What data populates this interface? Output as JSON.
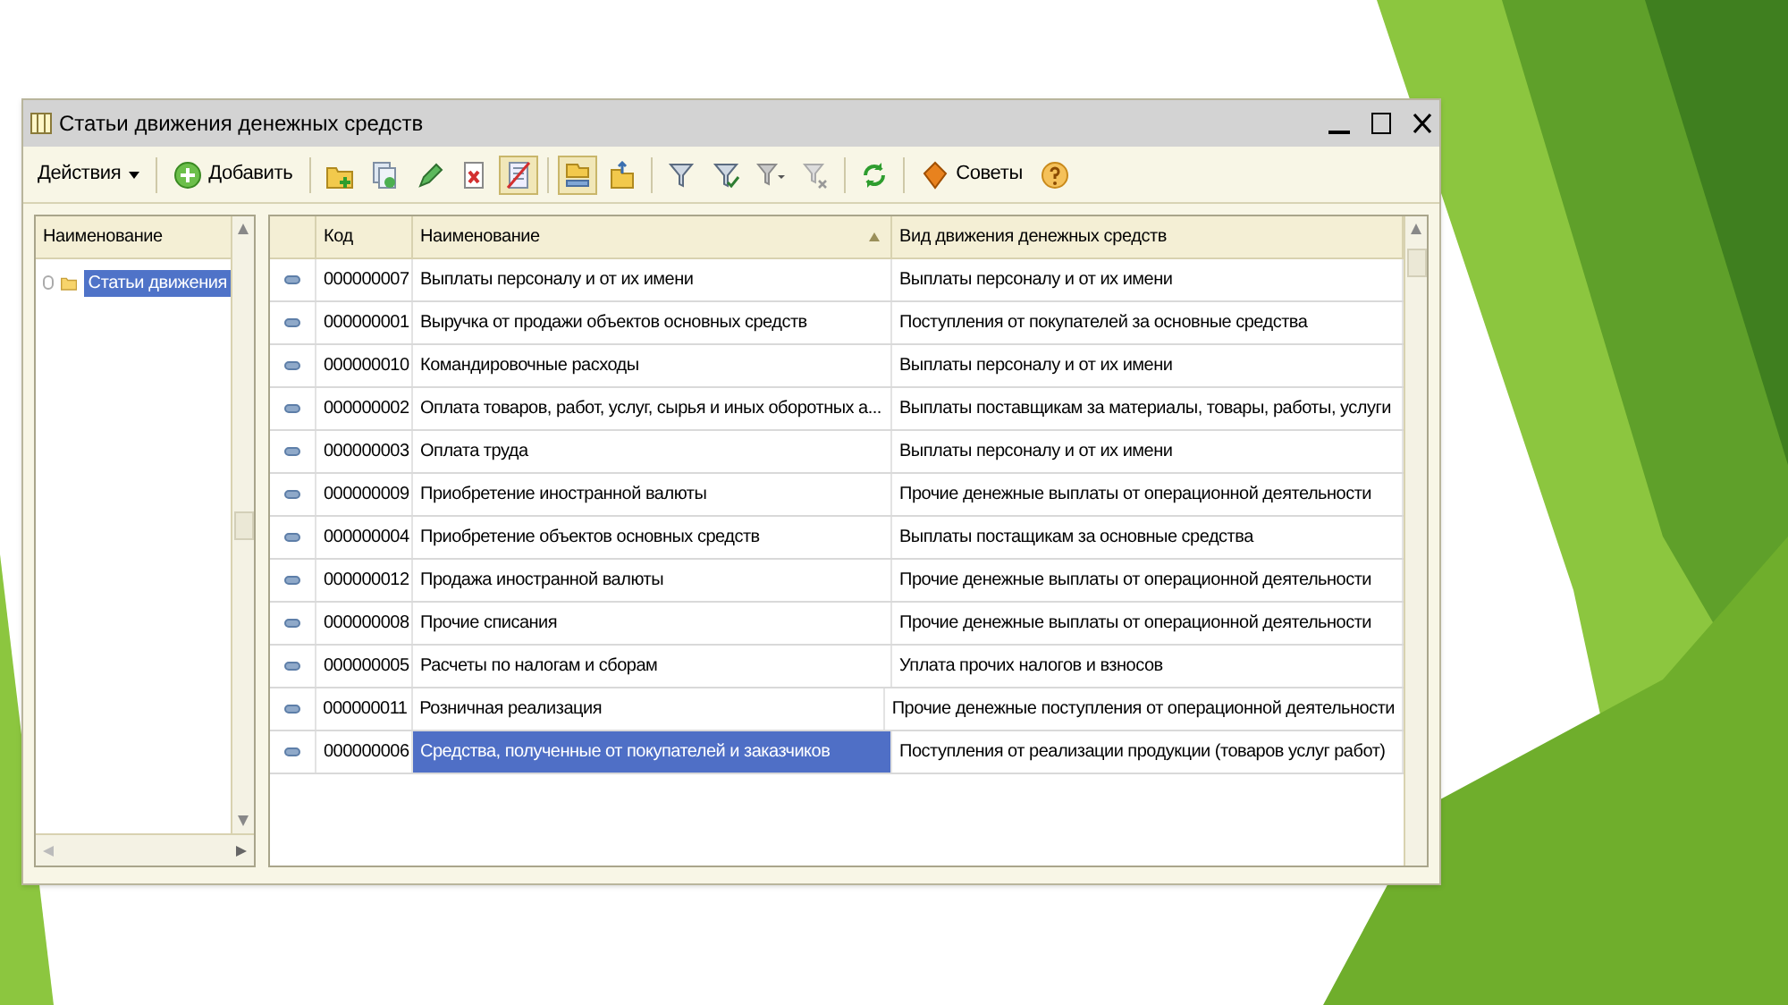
{
  "window": {
    "title": "Статьи движения денежных средств"
  },
  "toolbar": [
    {
      "kind": "menu",
      "label": "Действия"
    },
    {
      "kind": "separator"
    },
    {
      "kind": "add",
      "label": "Добавить"
    },
    {
      "kind": "separator"
    },
    {
      "kind": "new-folder",
      "pressed": false
    },
    {
      "kind": "copy",
      "pressed": false
    },
    {
      "kind": "edit",
      "pressed": false
    },
    {
      "kind": "delete",
      "pressed": false
    },
    {
      "kind": "mark-delete",
      "pressed": true
    },
    {
      "kind": "separator"
    },
    {
      "kind": "tree-view",
      "pressed": true
    },
    {
      "kind": "level-up",
      "pressed": false
    },
    {
      "kind": "separator"
    },
    {
      "kind": "filter",
      "pressed": false
    },
    {
      "kind": "filter-value",
      "pressed": false
    },
    {
      "kind": "filter-menu",
      "pressed": false
    },
    {
      "kind": "filter-off",
      "pressed": false
    },
    {
      "kind": "separator"
    },
    {
      "kind": "refresh",
      "pressed": false
    },
    {
      "kind": "separator"
    },
    {
      "kind": "tips",
      "label": "Советы"
    },
    {
      "kind": "help",
      "pressed": false
    }
  ],
  "tree": {
    "header": "Наименование",
    "items": [
      {
        "label": "Статьи движения",
        "selected": true
      }
    ]
  },
  "table": {
    "columns": [
      "Код",
      "Наименование",
      "Вид движения денежных средств"
    ],
    "rows": [
      {
        "code": "000000007",
        "name": "Выплаты персоналу и от их имени",
        "kind_of_flow": "Выплаты персоналу и от их имени",
        "selected": false
      },
      {
        "code": "000000001",
        "name": "Выручка от продажи объектов основных средств",
        "kind_of_flow": "Поступления от покупателей за основные средства",
        "selected": false
      },
      {
        "code": "000000010",
        "name": "Командировочные расходы",
        "kind_of_flow": "Выплаты персоналу и от их имени",
        "selected": false
      },
      {
        "code": "000000002",
        "name": "Оплата товаров, работ, услуг, сырья и иных оборотных а...",
        "kind_of_flow": "Выплаты поставщикам за материалы, товары, работы, услуги",
        "selected": false
      },
      {
        "code": "000000003",
        "name": "Оплата труда",
        "kind_of_flow": "Выплаты персоналу и от их имени",
        "selected": false
      },
      {
        "code": "000000009",
        "name": "Приобретение иностранной валюты",
        "kind_of_flow": "Прочие денежные выплаты от операционной деятельности",
        "selected": false
      },
      {
        "code": "000000004",
        "name": "Приобретение объектов основных средств",
        "kind_of_flow": "Выплаты постащикам за основные средства",
        "selected": false
      },
      {
        "code": "000000012",
        "name": "Продажа иностранной валюты",
        "kind_of_flow": "Прочие денежные выплаты от операционной деятельности",
        "selected": false
      },
      {
        "code": "000000008",
        "name": "Прочие списания",
        "kind_of_flow": "Прочие денежные выплаты от операционной деятельности",
        "selected": false
      },
      {
        "code": "000000005",
        "name": "Расчеты по налогам и сборам",
        "kind_of_flow": "Уплата прочих налогов и взносов",
        "selected": false
      },
      {
        "code": "000000011",
        "name": "Розничная реализация",
        "kind_of_flow": "Прочие денежные поступления от операционной деятельности",
        "selected": false
      },
      {
        "code": "000000006",
        "name": "Средства, полученные от покупателей и заказчиков",
        "kind_of_flow": "Поступления от реализации продукции (товаров услуг работ)",
        "selected": true
      }
    ]
  }
}
